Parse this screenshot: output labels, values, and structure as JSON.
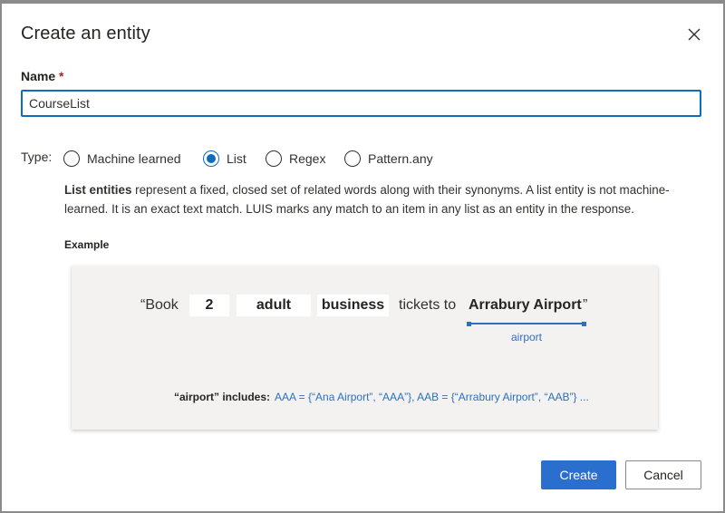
{
  "dialog": {
    "title": "Create an entity"
  },
  "name_field": {
    "label": "Name",
    "required_mark": "*",
    "value": "CourseList"
  },
  "type_field": {
    "label": "Type:",
    "options": [
      {
        "label": "Machine learned",
        "checked": false
      },
      {
        "label": "List",
        "checked": true
      },
      {
        "label": "Regex",
        "checked": false
      },
      {
        "label": "Pattern.any",
        "checked": false
      }
    ]
  },
  "description": {
    "bold_lead": "List entities",
    "text": " represent a fixed, closed set of related words along with their synonyms. A list entity is not machine-learned. It is an exact text match. LUIS marks any match to an item in any list as an entity in the response."
  },
  "example": {
    "label": "Example",
    "open_quote": "“Book",
    "chips": [
      "2",
      "adult",
      "business"
    ],
    "middle_text": "tickets to",
    "entity_text": "Arrabury Airport",
    "close_quote": "”",
    "entity_tag": "airport",
    "includes_label": "“airport” includes:",
    "includes_value": "AAA = {“Ana Airport”, “AAA”}, AAB = {“Arrabury Airport”, “AAB”} ..."
  },
  "buttons": {
    "create": "Create",
    "cancel": "Cancel"
  },
  "colors": {
    "accent": "#0f6cbd",
    "primary_button": "#2b6fce",
    "entity_blue": "#2b70c4",
    "required_red": "#a4262c",
    "example_background": "#f3f2f1"
  },
  "icons": {
    "close": "close-icon"
  }
}
